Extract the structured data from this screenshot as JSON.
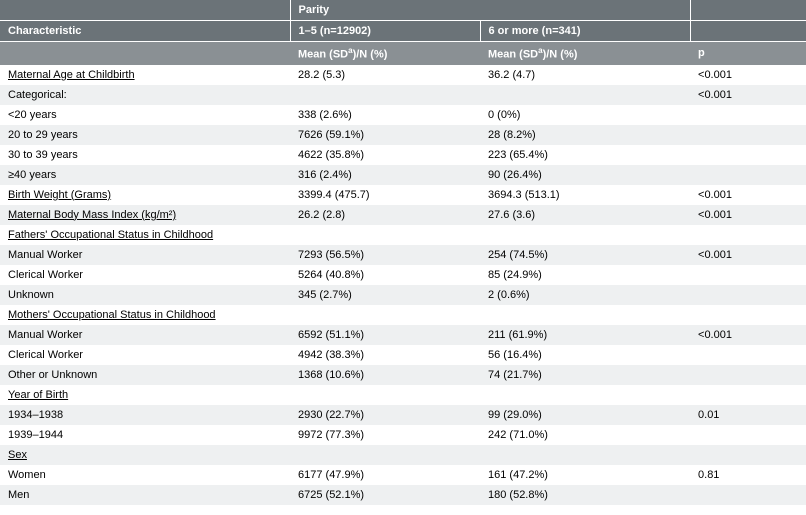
{
  "headers": {
    "parity": "Parity",
    "characteristic": "Characteristic",
    "group1": "1–5 (n=12902)",
    "group2": "6 or more (n=341)",
    "stat_label_pre": "Mean (SD",
    "stat_label_sup": "a",
    "stat_label_post": ")/N (%)",
    "p": "p"
  },
  "rows": [
    {
      "label": "Maternal Age at Childbirth",
      "c1": "28.2 (5.3)",
      "c2": "36.2 (4.7)",
      "p": "<0.001",
      "section": true
    },
    {
      "label": "Categorical:",
      "c1": "",
      "c2": "",
      "p": "<0.001"
    },
    {
      "label": "<20 years",
      "c1": "338 (2.6%)",
      "c2": "0 (0%)",
      "p": ""
    },
    {
      "label": "20 to 29 years",
      "c1": "7626 (59.1%)",
      "c2": "28 (8.2%)",
      "p": ""
    },
    {
      "label": "30 to 39 years",
      "c1": "4622 (35.8%)",
      "c2": "223 (65.4%)",
      "p": ""
    },
    {
      "label": "≥40 years",
      "c1": "316 (2.4%)",
      "c2": "90 (26.4%)",
      "p": ""
    },
    {
      "label": "Birth Weight (Grams)",
      "c1": "3399.4 (475.7)",
      "c2": "3694.3 (513.1)",
      "p": "<0.001",
      "section": true
    },
    {
      "label": "Maternal Body Mass Index (kg/m²)",
      "c1": "26.2 (2.8)",
      "c2": "27.6 (3.6)",
      "p": "<0.001",
      "section": true
    },
    {
      "label": "Fathers' Occupational Status in Childhood",
      "c1": "",
      "c2": "",
      "p": "",
      "section": true
    },
    {
      "label": "Manual Worker",
      "c1": "7293 (56.5%)",
      "c2": "254 (74.5%)",
      "p": "<0.001"
    },
    {
      "label": "Clerical Worker",
      "c1": "5264 (40.8%)",
      "c2": "85 (24.9%)",
      "p": ""
    },
    {
      "label": "Unknown",
      "c1": "345 (2.7%)",
      "c2": "2 (0.6%)",
      "p": ""
    },
    {
      "label": "Mothers' Occupational Status in Childhood",
      "c1": "",
      "c2": "",
      "p": "",
      "section": true
    },
    {
      "label": "Manual Worker",
      "c1": "6592 (51.1%)",
      "c2": "211 (61.9%)",
      "p": "<0.001"
    },
    {
      "label": "Clerical Worker",
      "c1": "4942 (38.3%)",
      "c2": "56 (16.4%)",
      "p": ""
    },
    {
      "label": "Other or Unknown",
      "c1": "1368 (10.6%)",
      "c2": "74 (21.7%)",
      "p": ""
    },
    {
      "label": "Year of Birth",
      "c1": "",
      "c2": "",
      "p": "",
      "section": true
    },
    {
      "label": "1934–1938",
      "c1": "2930 (22.7%)",
      "c2": "99 (29.0%)",
      "p": "0.01"
    },
    {
      "label": "1939–1944",
      "c1": "9972 (77.3%)",
      "c2": "242 (71.0%)",
      "p": ""
    },
    {
      "label": "Sex",
      "c1": "",
      "c2": "",
      "p": "",
      "section": true
    },
    {
      "label": "Women",
      "c1": "6177 (47.9%)",
      "c2": "161 (47.2%)",
      "p": "0.81"
    },
    {
      "label": "Men",
      "c1": "6725 (52.1%)",
      "c2": "180 (52.8%)",
      "p": ""
    }
  ]
}
